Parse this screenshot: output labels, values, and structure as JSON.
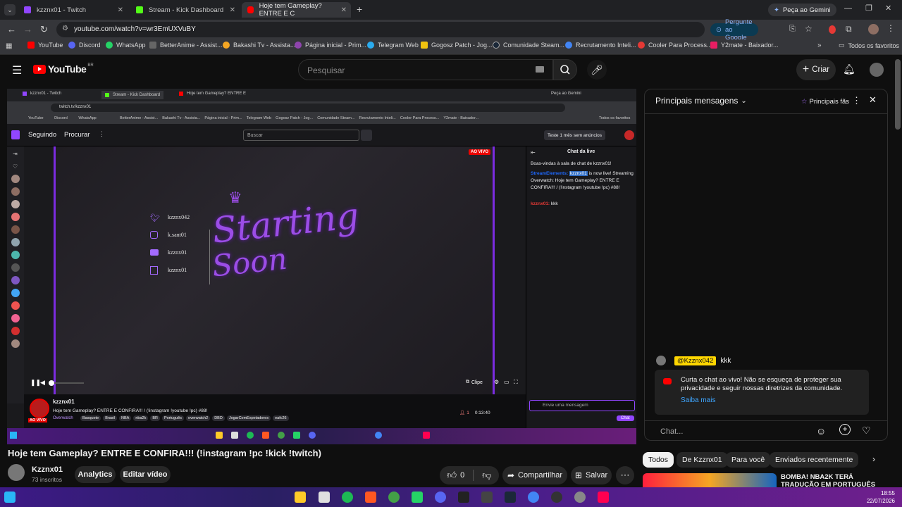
{
  "browser": {
    "tabs": [
      {
        "label": "kzznx01 - Twitch",
        "color": "#9146ff"
      },
      {
        "label": "Stream - Kick Dashboard",
        "color": "#53fc18"
      },
      {
        "label": "Hoje tem Gameplay? ENTRE E C",
        "color": "#ff0000"
      }
    ],
    "gemini_label": "Peça ao Gemini",
    "url": "youtube.com/watch?v=wr3EmUXVuBY",
    "google_ask_label": "Pergunte ao Google",
    "bookmarks": [
      "YouTube",
      "Discord",
      "WhatsApp",
      "BetterAnime - Assist...",
      "Bakashi Tv - Assista...",
      "Página inicial - Prim...",
      "Telegram Web",
      "Gogosz Patch - Jog...",
      "Comunidade Steam...",
      "Recrutamento Inteli...",
      "Cooler Para Process...",
      "Y2mate - Baixador..."
    ],
    "bookmarks_all": "Todos os favoritos"
  },
  "yt": {
    "logo_text": "YouTube",
    "region": "BR",
    "search_placeholder": "Pesquisar",
    "create_label": "Criar"
  },
  "stream": {
    "inner_tabs": [
      "kzznx01 - Twitch",
      "Stream - Kick Dashboard",
      "Hoje tem Gameplay? ENTRE E"
    ],
    "inner_gemini": "Peça ao Gemini",
    "inner_url": "twitch.tv/kzznx01",
    "inner_bookmarks": [
      "YouTube",
      "Discord",
      "WhatsApp",
      "BetterAnime - Assist...",
      "Bakashi Tv - Assista...",
      "Página inicial - Prim...",
      "Telegram Web",
      "Gogosz Patch - Jog...",
      "Comunidade Steam...",
      "Recrutamento Inteli...",
      "Cooler Para Process...",
      "Y2mate - Baixador..."
    ],
    "inner_bookmarks_all": "Todos os favoritos",
    "nav_following": "Seguindo",
    "nav_browse": "Procurar",
    "search_placeholder": "Buscar",
    "promo": "Teste 1 mês sem anúncios",
    "live_badge": "AO VIVO",
    "socials": [
      {
        "icon": "twitter-icon",
        "handle": "kzznx042"
      },
      {
        "icon": "instagram-icon",
        "handle": "k.sant01"
      },
      {
        "icon": "youtube-icon",
        "handle": "kzznx01"
      },
      {
        "icon": "twitch-icon",
        "handle": "kzznx01"
      }
    ],
    "overlay_title_1": "Starting",
    "overlay_title_2": "Soon",
    "clip_label": "Clipe",
    "chat_title": "Chat da live",
    "chat_welcome": "Boas-vindas à sala de chat de kzznx01!",
    "chat_bot_name": "StreamElements:",
    "chat_mention": "kzznx01",
    "chat_bot_msg": "is now live! Streaming Overwatch: Hoje tem Gameplay? ENTRE E CONFIRA!!! / (!instagram !youtube !pc) #88!",
    "chat_user2": "kzznx01:",
    "chat_user2_msg": "kkk",
    "chat_input_placeholder": "Envie uma mensagem",
    "chat_btn": "Chat",
    "channel_name": "kzznx01",
    "stream_title": "Hoje tem Gameplay? ENTRE E CONFIRA!!! / (!instagram !youtube !pc) #88!",
    "game": "Overwatch",
    "tags": [
      "Basquete",
      "Brasil",
      "NBA",
      "nba2k",
      "BR",
      "Português",
      "overwatch2",
      "DBD",
      "JogarComEspetadores",
      "eafc26"
    ],
    "viewers": "1",
    "uptime": "0:13:40",
    "avatar_live": "AO VIVO"
  },
  "chat": {
    "title": "Principais mensagens",
    "fans_label": "Principais fãs",
    "msg_user": "@Kzznx042",
    "msg_text": "kkk",
    "notice_text": "Curta o chat ao vivo! Não se esqueça de proteger sua privacidade e seguir nossas diretrizes da comunidade.",
    "notice_link": "Saiba mais",
    "input_placeholder": "Chat..."
  },
  "video": {
    "title": "Hoje tem Gameplay? ENTRE E CONFIRA!!! (!instagram !pc !kick !twitch)",
    "channel": "Kzznx01",
    "subscribers": "73 inscritos",
    "analytics_label": "Analytics",
    "edit_label": "Editar vídeo",
    "likes": "0",
    "share_label": "Compartilhar",
    "save_label": "Salvar"
  },
  "chips": [
    "Todos",
    "De Kzznx01",
    "Para você",
    "Enviados recentemente"
  ],
  "reco": {
    "title": "BOMBA! NBA2K TERÁ TRADUÇÃO EM PORTUGUÊS"
  },
  "system": {
    "time": "18:55",
    "date": "22/07/2026"
  }
}
